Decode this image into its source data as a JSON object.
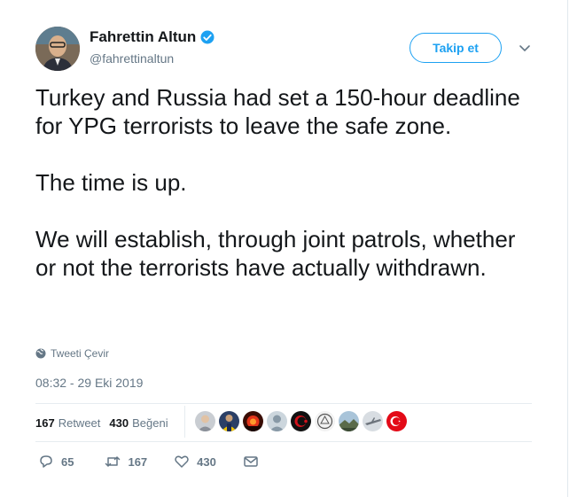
{
  "author": {
    "name": "Fahrettin Altun",
    "handle": "@fahrettinaltun",
    "verified": true
  },
  "follow_label": "Takip et",
  "tweet": {
    "paragraphs": [
      "Turkey and Russia had set a 150-hour deadline for YPG terrorists to leave the safe zone.",
      "The time is up.",
      "We will establish, through joint patrols, whether or not the terrorists have actually withdrawn."
    ]
  },
  "translate_label": "Tweeti Çevir",
  "timestamp": "08:32 - 29 Eki 2019",
  "stats": {
    "retweets_count": "167",
    "retweets_label": "Retweet",
    "likes_count": "430",
    "likes_label": "Beğeni"
  },
  "likers": [
    {
      "icon": "profile-photo-icon"
    },
    {
      "icon": "profile-photo-icon"
    },
    {
      "icon": "sunset-photo-icon"
    },
    {
      "icon": "default-avatar-icon"
    },
    {
      "icon": "turkish-flag-dark-icon"
    },
    {
      "icon": "emblem-photo-icon"
    },
    {
      "icon": "landscape-photo-icon"
    },
    {
      "icon": "aircraft-photo-icon"
    },
    {
      "icon": "turkish-flag-icon"
    }
  ],
  "actions": {
    "replies": "65",
    "retweets": "167",
    "likes": "430"
  },
  "colors": {
    "accent": "#1da1f2",
    "text": "#14171a",
    "muted": "#657786"
  }
}
